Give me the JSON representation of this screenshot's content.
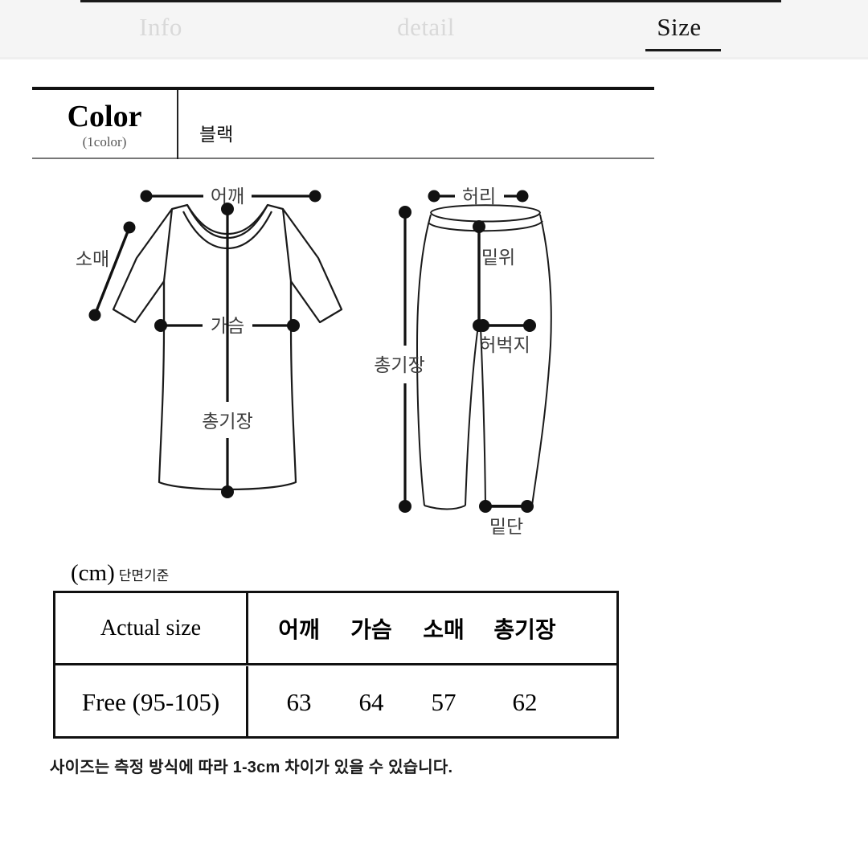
{
  "tabs": [
    {
      "label": "Info",
      "active": false
    },
    {
      "label": "detail",
      "active": false
    },
    {
      "label": "Size",
      "active": true
    }
  ],
  "color_section": {
    "title": "Color",
    "subtitle": "(1color)",
    "value": "블랙"
  },
  "diagrams": {
    "top": {
      "name": "t-shirt",
      "labels": {
        "shoulder": "어깨",
        "sleeve": "소매",
        "chest": "가슴",
        "length": "총기장"
      }
    },
    "bottom": {
      "name": "pants",
      "labels": {
        "waist": "허리",
        "rise": "밑위",
        "thigh": "허벅지",
        "length": "총기장",
        "hem": "밑단"
      }
    }
  },
  "size_table": {
    "unit": "(cm)",
    "unit_note": "단면기준",
    "headers": [
      "Actual size",
      "어깨",
      "가슴",
      "소매",
      "총기장"
    ],
    "rows": [
      {
        "label": "Free (95-105)",
        "values": [
          "63",
          "64",
          "57",
          "62"
        ]
      }
    ],
    "note": "사이즈는 측정 방식에 따라 1-3cm 차이가 있을 수 있습니다."
  },
  "colors": {
    "tab_active": "#141414",
    "tab_inactive": "#d9d9d9",
    "tabbar_bg": "#f5f5f5",
    "rule": "#111111",
    "diagram_label": "#3d3d3d",
    "page_bg": "#ffffff"
  }
}
